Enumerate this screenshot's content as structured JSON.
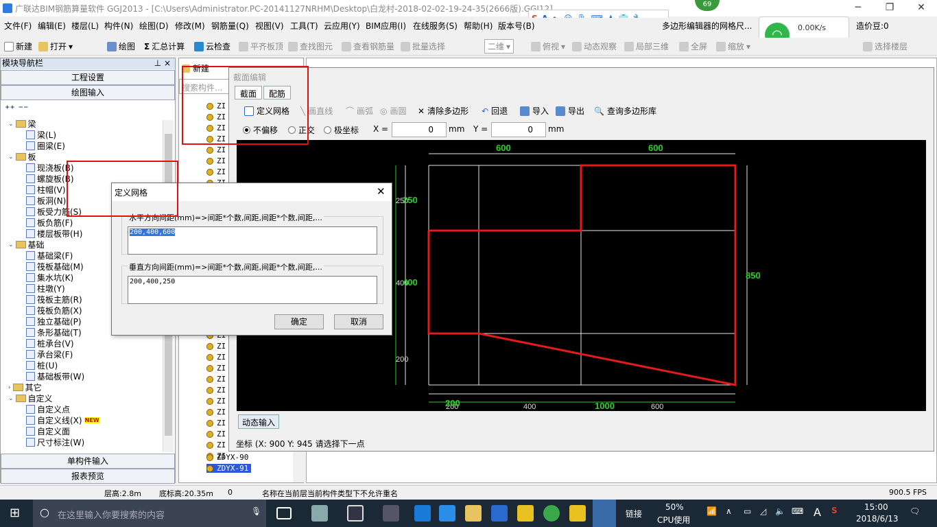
{
  "title": "广联达BIM钢筋算量软件 GGJ2013 - [C:\\Users\\Administrator.PC-20141127NRHM\\Desktop\\白龙村-2018-02-02-19-24-35(2666版).GGJ12]",
  "badge": "69",
  "menu": [
    "文件(F)",
    "编辑(E)",
    "楼层(L)",
    "构件(N)",
    "绘图(D)",
    "修改(M)",
    "钢筋量(Q)",
    "视图(V)",
    "工具(T)",
    "云应用(Y)",
    "BIM应用(I)",
    "在线服务(S)",
    "帮助(H)",
    "版本号(B)",
    "多边形编辑器的网格尺...",
    "造价豆:0"
  ],
  "net": {
    "speed": "0.00K/s",
    "count": "0"
  },
  "toolbar": {
    "new": "新建",
    "open": "打开",
    "draw": "绘图",
    "sum": "汇总计算",
    "cloud_check": "云检查",
    "flat_top": "平齐板顶",
    "find": "查找图元",
    "view_qty": "查看钢筋量",
    "batch": "批量选择",
    "view_mode": "二维",
    "top_view": "俯视",
    "dyn_view": "动态观察",
    "local3d": "局部三维",
    "full": "全屏",
    "zoom": "缩放",
    "select_floor": "选择楼层"
  },
  "left": {
    "header": "模块导航栏",
    "pin": "⊥ ×",
    "btn_project": "工程设置",
    "btn_draw": "绘图输入",
    "btn_single": "单构件输入",
    "btn_report": "报表预览",
    "tree": [
      {
        "t": "梁",
        "lvl": 1,
        "folder": true
      },
      {
        "t": "梁(L)",
        "lvl": 2
      },
      {
        "t": "圈梁(E)",
        "lvl": 2
      },
      {
        "t": "板",
        "lvl": 1,
        "folder": true
      },
      {
        "t": "现浇板(B)",
        "lvl": 2
      },
      {
        "t": "螺旋板(B)",
        "lvl": 2
      },
      {
        "t": "柱帽(V)",
        "lvl": 2
      },
      {
        "t": "板洞(N)",
        "lvl": 2
      },
      {
        "t": "板受力筋(S)",
        "lvl": 2
      },
      {
        "t": "板负筋(F)",
        "lvl": 2
      },
      {
        "t": "楼层板带(H)",
        "lvl": 2
      },
      {
        "t": "基础",
        "lvl": 1,
        "folder": true
      },
      {
        "t": "基础梁(F)",
        "lvl": 2
      },
      {
        "t": "筏板基础(M)",
        "lvl": 2
      },
      {
        "t": "集水坑(K)",
        "lvl": 2
      },
      {
        "t": "柱墩(Y)",
        "lvl": 2
      },
      {
        "t": "筏板主筋(R)",
        "lvl": 2
      },
      {
        "t": "筏板负筋(X)",
        "lvl": 2
      },
      {
        "t": "独立基础(P)",
        "lvl": 2
      },
      {
        "t": "条形基础(T)",
        "lvl": 2
      },
      {
        "t": "桩承台(V)",
        "lvl": 2
      },
      {
        "t": "承台梁(F)",
        "lvl": 2
      },
      {
        "t": "桩(U)",
        "lvl": 2
      },
      {
        "t": "基础板带(W)",
        "lvl": 2
      },
      {
        "t": "其它",
        "lvl": 1,
        "folder": true,
        "collapsed": true
      },
      {
        "t": "自定义",
        "lvl": 1,
        "folder": true
      },
      {
        "t": "自定义点",
        "lvl": 2
      },
      {
        "t": "自定义线(X)",
        "lvl": 2,
        "new": "NEW"
      },
      {
        "t": "自定义面",
        "lvl": 2
      },
      {
        "t": "尺寸标注(W)",
        "lvl": 2
      }
    ]
  },
  "mid": {
    "new": "新建",
    "search_placeholder": "搜索构件...",
    "items": [
      "ZI",
      "ZI",
      "ZI",
      "ZI",
      "ZI",
      "ZI",
      "ZI",
      "ZI",
      "ZI",
      "ZI",
      "ZI",
      "ZI",
      "ZI",
      "ZI",
      "ZI",
      "ZI"
    ],
    "item90": "ZDYX-90",
    "item91": "ZDYX-91"
  },
  "section": {
    "title": "截面编辑",
    "tab1": "截面",
    "tab2": "配筋",
    "tools": {
      "define_grid": "定义网格",
      "line": "画直线",
      "arc": "画弧",
      "circle": "画圆",
      "clear": "清除多边形",
      "undo": "回退",
      "import": "导入",
      "export": "导出",
      "query": "查询多边形库"
    },
    "opts": {
      "no_offset": "不偏移",
      "ortho": "正交",
      "polar": "极坐标",
      "x_label": "X =",
      "x_val": "0",
      "y_label": "Y =",
      "y_val": "0",
      "unit": "mm"
    },
    "dyn": "动态输入",
    "coord": "坐标 (X: 900 Y: 945 请选择下一点"
  },
  "canvas": {
    "top_dims": [
      "600",
      "600"
    ],
    "right_dim": "850",
    "left_dims": [
      "250",
      "400",
      "200"
    ],
    "left_green": [
      "250",
      "400"
    ],
    "bottom_dims": [
      "200",
      "400",
      "600"
    ],
    "bottom_green": [
      "200",
      "1000"
    ]
  },
  "dialog": {
    "title": "定义网格",
    "h_label": "水平方向间距(mm)=>间距*个数,间距,间距*个数,间距,...",
    "h_value": "200,400,600",
    "v_label": "垂直方向间距(mm)=>间距*个数,间距,间距*个数,间距,...",
    "v_value": "200,400,250",
    "ok": "确定",
    "cancel": "取消"
  },
  "status": {
    "floor_h": "层高:2.8m",
    "base_h": "底标高:20.35m",
    "zero": "0",
    "msg": "名称在当前层当前构件类型下不允许重名",
    "fps": "900.5 FPS"
  },
  "taskbar": {
    "search": "在这里输入你要搜索的内容",
    "link": "链接",
    "cpu": "50%",
    "cpu_label": "CPU使用",
    "ime": "A",
    "time": "15:00",
    "date": "2018/6/13"
  }
}
